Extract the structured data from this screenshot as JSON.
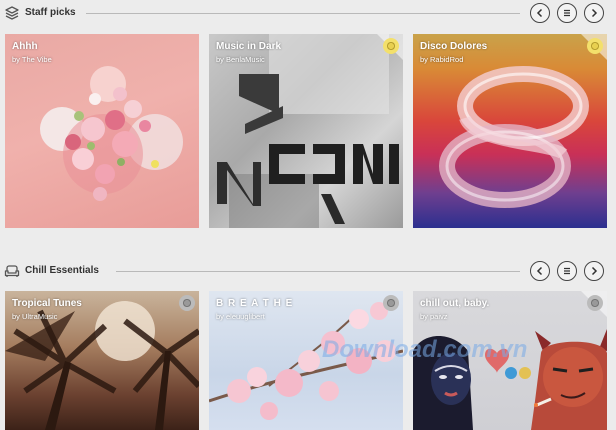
{
  "sections": [
    {
      "title": "Staff picks",
      "icon": "layers-icon",
      "cards": [
        {
          "title": "Ahhh",
          "by": "by The Vibe"
        },
        {
          "title": "Music in Dark",
          "by": "by BenlaMusic"
        },
        {
          "title": "Disco Dolores",
          "by": "by RabidRod"
        }
      ]
    },
    {
      "title": "Chill Essentials",
      "icon": "sofa-icon",
      "cards": [
        {
          "title": "Tropical Tunes",
          "by": "by UltraMusic"
        },
        {
          "title": "B R E A T H E",
          "by": "by eleuuglibert"
        },
        {
          "title": "chill out, baby.",
          "by": "by paivz"
        }
      ]
    }
  ],
  "nav": {
    "prev": "chevron-left-icon",
    "list": "list-icon",
    "next": "chevron-right-icon"
  },
  "watermark": "Download.com.vn"
}
